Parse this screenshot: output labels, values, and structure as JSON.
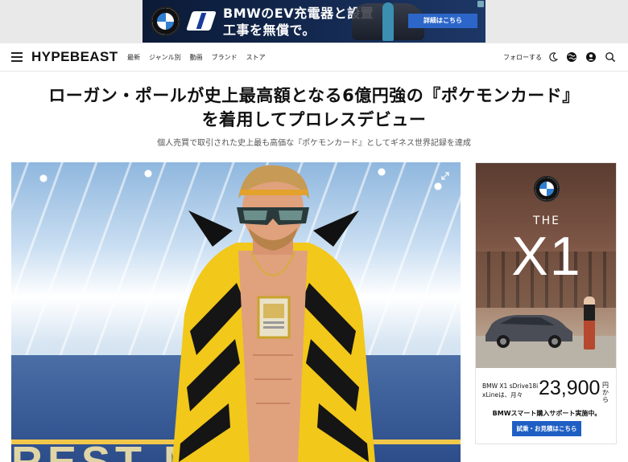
{
  "top_ad": {
    "headline": "BMWのEV充電器と設置工事を無償で。",
    "cta": "詳細はこちら"
  },
  "nav": {
    "logo": "HYPEBEAST",
    "links": [
      "最新",
      "ジャンル別",
      "動画",
      "ブランド",
      "ストア"
    ],
    "follow": "フォローする",
    "icons": [
      "menu-icon",
      "moon-icon",
      "globe-icon",
      "user-icon",
      "search-icon"
    ]
  },
  "article": {
    "title": "ローガン・ポールが史上最高額となる6億円強の『ポケモンカード』を着用してプロレスデビュー",
    "subtitle": "個人売買で取引された史上最も高価な『ポケモンカード』としてギネス世界記録を達成",
    "image_sign_text": "REST     MA"
  },
  "side_ad": {
    "the": "THE",
    "model_name": "X1",
    "model_line": "BMW X1 sDrive18i xLineは、月々",
    "price": "23,900",
    "price_suffix": "円から",
    "support": "BMWスマート購入サポート実施中。",
    "cta": "試乗・お見積はこちら"
  },
  "colors": {
    "accent_blue": "#1f5fc4",
    "ad_navy": "#0b1a36",
    "text": "#111111"
  }
}
